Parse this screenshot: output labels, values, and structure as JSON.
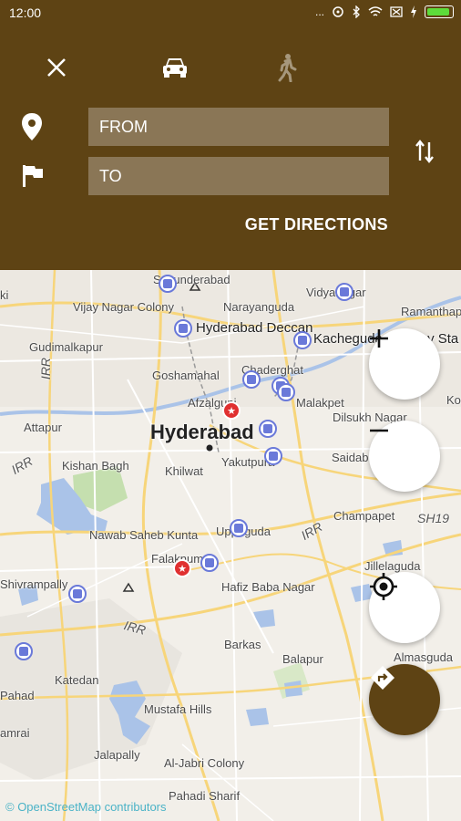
{
  "status": {
    "time": "12:00",
    "dots": "..."
  },
  "header": {
    "from_label": "FROM",
    "to_label": "TO",
    "get_directions": "GET DIRECTIONS"
  },
  "map": {
    "labels": {
      "secunderabad": "Secunderabad",
      "vidyanagar": "Vidyanagar",
      "vijay_nagar": "Vijay Nagar Colony",
      "narayanguda": "Narayanguda",
      "ramanthapur": "Ramanthapur",
      "hyd_deccan": "Hyderabad Deccan",
      "kacheguda": "Kacheguda Railway Sta",
      "gudimalkapur": "Gudimalkapur",
      "irr1": "IRR",
      "goshamahal": "Goshamahal",
      "chaderghat": "Chaderghat",
      "afzalgunj": "Afzalgunj",
      "malakpet": "Malakpet",
      "ko": "Ko",
      "attapur": "Attapur",
      "hyderabad": "Hyderabad",
      "dilsukh": "Dilsukh Nagar",
      "irr2": "IRR",
      "kishan_bagh": "Kishan Bagh",
      "khilwat": "Khilwat",
      "yakutpura": "Yakutpura",
      "saidabad": "Saidab",
      "champapet": "Champapet",
      "sh19": "SH19",
      "irr3": "IRR",
      "nawab": "Nawab Saheb Kunta",
      "uppuguda": "Uppuguda",
      "falaknuma": "Falaknuma",
      "jillelaguda": "Jillelaguda",
      "shivrampally": "Shivrampally",
      "hafiz": "Hafiz Baba Nagar",
      "irr4": "IRR",
      "barkas": "Barkas",
      "balapur": "Balapur",
      "almasguda": "Almasguda",
      "katedan": "Katedan",
      "pahad": "Pahad",
      "mustafa": "Mustafa Hills",
      "amrai": "amrai",
      "jalapally": "Jalapally",
      "jabri": "Al-Jabri Colony",
      "pahadi": "Pahadi Sharif",
      "ki": "ki"
    },
    "attribution": "© OpenStreetMap contributors"
  },
  "icons": {
    "close": "close-icon",
    "car": "car-icon",
    "walk": "walk-icon",
    "location": "location-pin-icon",
    "flag": "flag-icon",
    "swap": "swap-icon",
    "zoom_in": "plus-icon",
    "zoom_out": "minus-icon",
    "locate": "my-location-icon",
    "directions": "directions-icon"
  },
  "colors": {
    "header": "#5e4314",
    "field": "#8a7656",
    "metro": "#6a79d9",
    "water": "#aac3e8",
    "road": "#f7d57a"
  }
}
